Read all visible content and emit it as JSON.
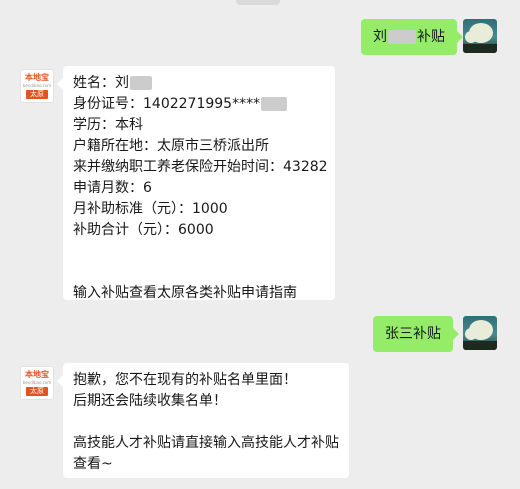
{
  "messages": [
    {
      "sender": "self",
      "text": "刘",
      "text_after": "补贴"
    },
    {
      "sender": "bot",
      "lines": [
        "姓名：刘",
        "身份证号：1402271995****",
        "学历：本科",
        "户籍所在地：太原市三桥派出所",
        "来并缴纳职工养老保险开始时间：43282",
        "申请月数：6",
        "月补助标准（元）：1000",
        "补助合计（元）：6000"
      ],
      "footer": "输入补贴查看太原各类补贴申请指南"
    },
    {
      "sender": "self",
      "text": "张三补贴"
    },
    {
      "sender": "bot",
      "lines": [
        "抱歉，您不在现有的补贴名单里面！",
        "后期还会陆续收集名单！"
      ],
      "footer_lines": [
        "高技能人才补贴请直接输入高技能人才补贴",
        "查看~"
      ]
    }
  ],
  "bot_avatar": {
    "brand": "本地宝",
    "site": "bendibao.com",
    "city": "太原"
  },
  "colors": {
    "background": "#ededed",
    "outgoing_bubble": "#95ec69",
    "incoming_bubble": "#ffffff",
    "brand_orange": "#e2531d"
  }
}
